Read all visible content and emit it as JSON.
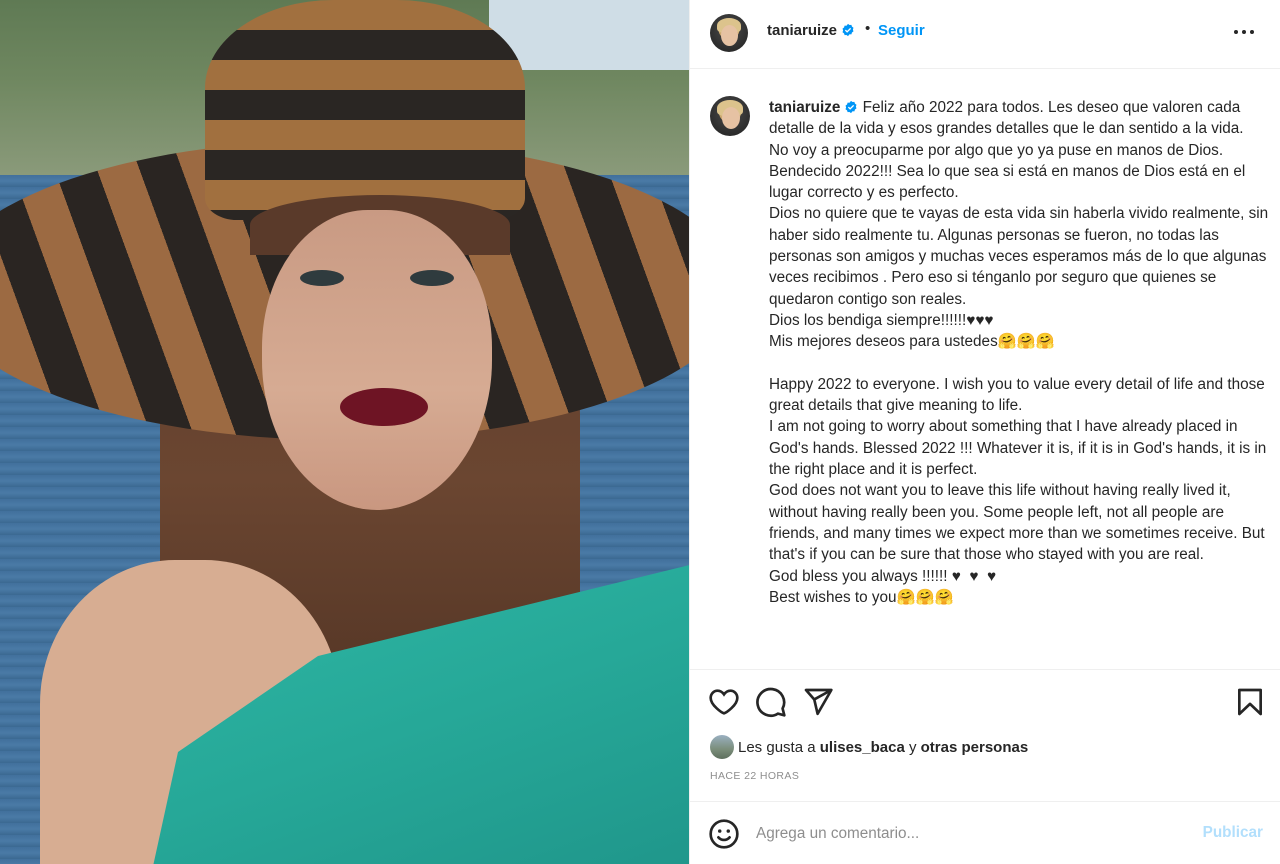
{
  "post": {
    "username": "taniaruize",
    "follow_label": "Seguir",
    "dot": "•",
    "caption_body": " Feliz año 2022 para todos. Les deseo que valoren cada detalle de la vida y esos grandes detalles que le dan sentido a la vida.\nNo voy a preocuparme por algo que yo ya puse en manos de Dios. Bendecido 2022!!! Sea lo que sea si está en manos de Dios está en el lugar correcto y es perfecto.\nDios no quiere que te vayas de esta vida sin haberla vivido realmente, sin haber sido realmente tu. Algunas personas se fueron, no todas las personas son amigos y muchas veces esperamos más de lo que algunas veces recibimos . Pero eso si ténganlo por seguro que quienes se quedaron contigo son reales.\nDios los bendiga siempre!!!!!!♥♥♥\nMis mejores deseos para ustedes🤗🤗🤗\n\nHappy 2022 to everyone. I wish you to value every detail of life and those great details that give meaning to life.\nI am not going to worry about something that I have already placed in God's hands. Blessed 2022 !!! Whatever it is, if it is in God's hands, it is in the right place and it is perfect.\nGod does not want you to leave this life without having really lived it, without having really been you. Some people left, not all people are friends, and many times we expect more than we sometimes receive. But that's if you can be sure that those who stayed with you are real.\nGod bless you always !!!!!! ♥  ♥  ♥\nBest wishes to you🤗🤗🤗",
    "likes_prefix": "Les gusta a ",
    "likes_user": "ulises_baca",
    "likes_mid": " y ",
    "likes_others": "otras personas",
    "time": "HACE 22 HORAS",
    "comment_placeholder": "Agrega un comentario...",
    "publish_label": "Publicar"
  },
  "icons": {
    "like": "heart-icon",
    "comment": "comment-icon",
    "share": "send-icon",
    "save": "bookmark-icon",
    "emoji": "emoji-icon",
    "more": "more-options-icon",
    "verified": "verified-badge-icon"
  },
  "colors": {
    "accent": "#0095f6",
    "publish_disabled": "#b2dffc",
    "muted": "#8e8e8e",
    "text": "#262626"
  }
}
